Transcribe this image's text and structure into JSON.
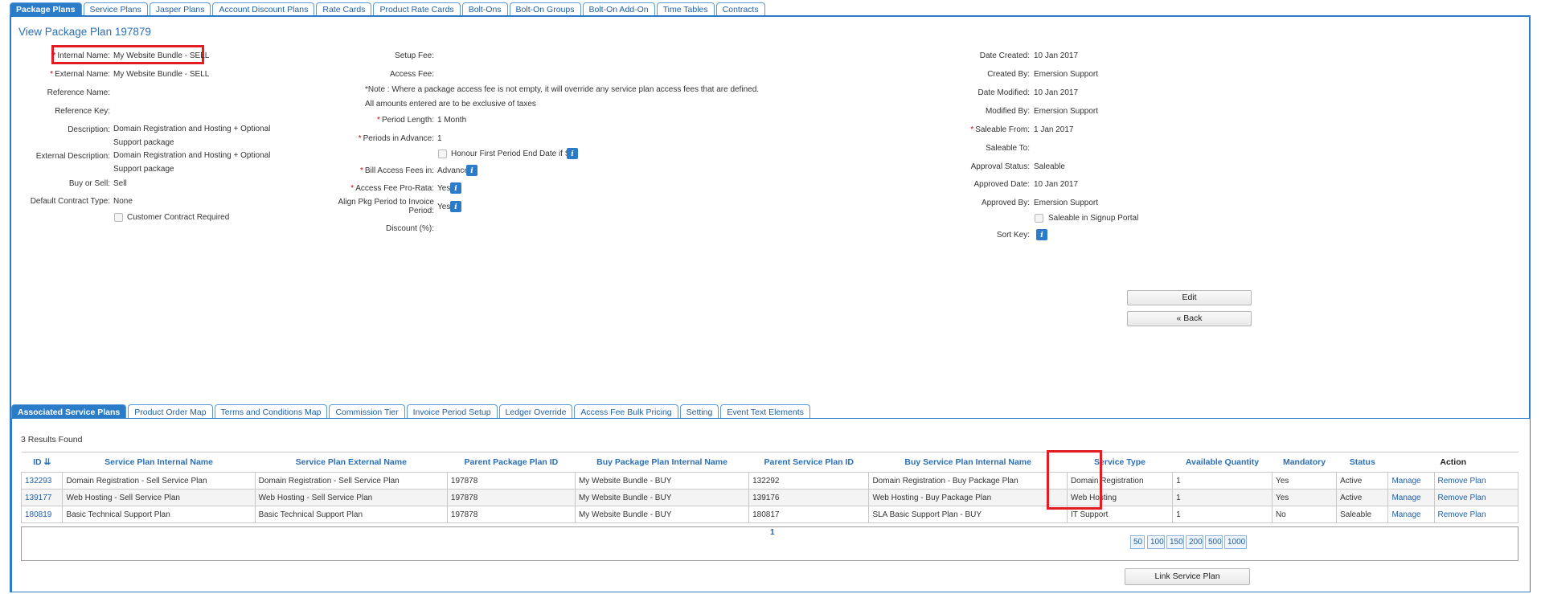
{
  "top_tabs": [
    "Package Plans",
    "Service Plans",
    "Jasper Plans",
    "Account Discount Plans",
    "Rate Cards",
    "Product Rate Cards",
    "Bolt-Ons",
    "Bolt-On Groups",
    "Bolt-On Add-On",
    "Time Tables",
    "Contracts"
  ],
  "page_title": "View Package Plan 197879",
  "left": {
    "internal_name_label": "Internal Name:",
    "internal_name": "My Website Bundle - SELL",
    "external_name_label": "External Name:",
    "external_name": "My Website Bundle - SELL",
    "reference_name_label": "Reference Name:",
    "reference_key_label": "Reference Key:",
    "description_label": "Description:",
    "description": "Domain Registration and Hosting + Optional Support package",
    "external_description_label": "External Description:",
    "external_description": "Domain Registration and Hosting + Optional Support package",
    "buy_or_sell_label": "Buy or Sell:",
    "buy_or_sell": "Sell",
    "default_contract_type_label": "Default Contract Type:",
    "default_contract_type": "None",
    "customer_contract_required": "Customer Contract Required"
  },
  "middle": {
    "setup_fee_label": "Setup Fee:",
    "access_fee_label": "Access Fee:",
    "note": "*Note : Where a package access fee is not empty, it will override any service plan access fees that are defined.",
    "taxes_note": "All amounts entered are to be exclusive of taxes",
    "period_length_label": "Period Length:",
    "period_length": "1 Month",
    "periods_in_advance_label": "Periods in Advance:",
    "periods_in_advance": "1",
    "honour_first_period": "Honour First Period End Date if Set",
    "bill_access_fees_label": "Bill Access Fees in:",
    "bill_access_fees": "Advance",
    "access_fee_prorata_label": "Access Fee Pro-Rata:",
    "access_fee_prorata": "Yes",
    "align_pkg_label_1": "Align Pkg Period to Invoice",
    "align_pkg_label_2": "Period:",
    "align_pkg": "Yes",
    "discount_label": "Discount (%):"
  },
  "right": {
    "date_created_label": "Date Created:",
    "date_created": "10 Jan 2017",
    "created_by_label": "Created By:",
    "created_by": "Emersion Support",
    "date_modified_label": "Date Modified:",
    "date_modified": "10 Jan 2017",
    "modified_by_label": "Modified By:",
    "modified_by": "Emersion Support",
    "saleable_from_label": "Saleable From:",
    "saleable_from": "1 Jan 2017",
    "saleable_to_label": "Saleable To:",
    "approval_status_label": "Approval Status:",
    "approval_status": "Saleable",
    "approved_date_label": "Approved Date:",
    "approved_date": "10 Jan 2017",
    "approved_by_label": "Approved By:",
    "approved_by": "Emersion Support",
    "saleable_signup": "Saleable in Signup Portal",
    "sort_key_label": "Sort Key:"
  },
  "buttons": {
    "edit": "Edit",
    "back": "« Back",
    "link_service_plan": "Link Service Plan"
  },
  "bottom_tabs": [
    "Associated Service Plans",
    "Product Order Map",
    "Terms and Conditions Map",
    "Commission Tier",
    "Invoice Period Setup",
    "Ledger Override",
    "Access Fee Bulk Pricing",
    "Setting",
    "Event Text Elements"
  ],
  "results_text": "3 Results Found",
  "table": {
    "headers": [
      "ID",
      "Service Plan Internal Name",
      "Service Plan External Name",
      "Parent Package Plan ID",
      "Buy Package Plan Internal Name",
      "Parent Service Plan ID",
      "Buy Service Plan Internal Name",
      "Service Type",
      "Available Quantity",
      "Mandatory",
      "Status",
      "Action"
    ],
    "rows": [
      {
        "id": "132293",
        "internal": "Domain Registration - Sell Service Plan",
        "external": "Domain Registration - Sell Service Plan",
        "parent_pkg": "197878",
        "buy_pkg": "My Website Bundle - BUY",
        "parent_sp": "132292",
        "buy_sp": "Domain Registration - Buy Package Plan",
        "type": "Domain Registration",
        "qty": "1",
        "mandatory": "Yes",
        "status": "Active",
        "manage": "Manage",
        "remove": "Remove Plan"
      },
      {
        "id": "139177",
        "internal": "Web Hosting - Sell Service Plan",
        "external": "Web Hosting - Sell Service Plan",
        "parent_pkg": "197878",
        "buy_pkg": "My Website Bundle - BUY",
        "parent_sp": "139176",
        "buy_sp": "Web Hosting - Buy Package Plan",
        "type": "Web Hosting",
        "qty": "1",
        "mandatory": "Yes",
        "status": "Active",
        "manage": "Manage",
        "remove": "Remove Plan"
      },
      {
        "id": "180819",
        "internal": "Basic Technical Support Plan",
        "external": "Basic Technical Support Plan",
        "parent_pkg": "197878",
        "buy_pkg": "My Website Bundle - BUY",
        "parent_sp": "180817",
        "buy_sp": "SLA Basic Support Plan - BUY",
        "type": "IT Support",
        "qty": "1",
        "mandatory": "No",
        "status": "Saleable",
        "manage": "Manage",
        "remove": "Remove Plan"
      }
    ]
  },
  "pager": {
    "current_page": "1",
    "sizes": [
      "50",
      "100",
      "150",
      "200",
      "500",
      "1000"
    ]
  },
  "colors": {
    "accent": "#2b7cc8",
    "highlight": "#e31b23",
    "link": "#1f5fa6"
  }
}
